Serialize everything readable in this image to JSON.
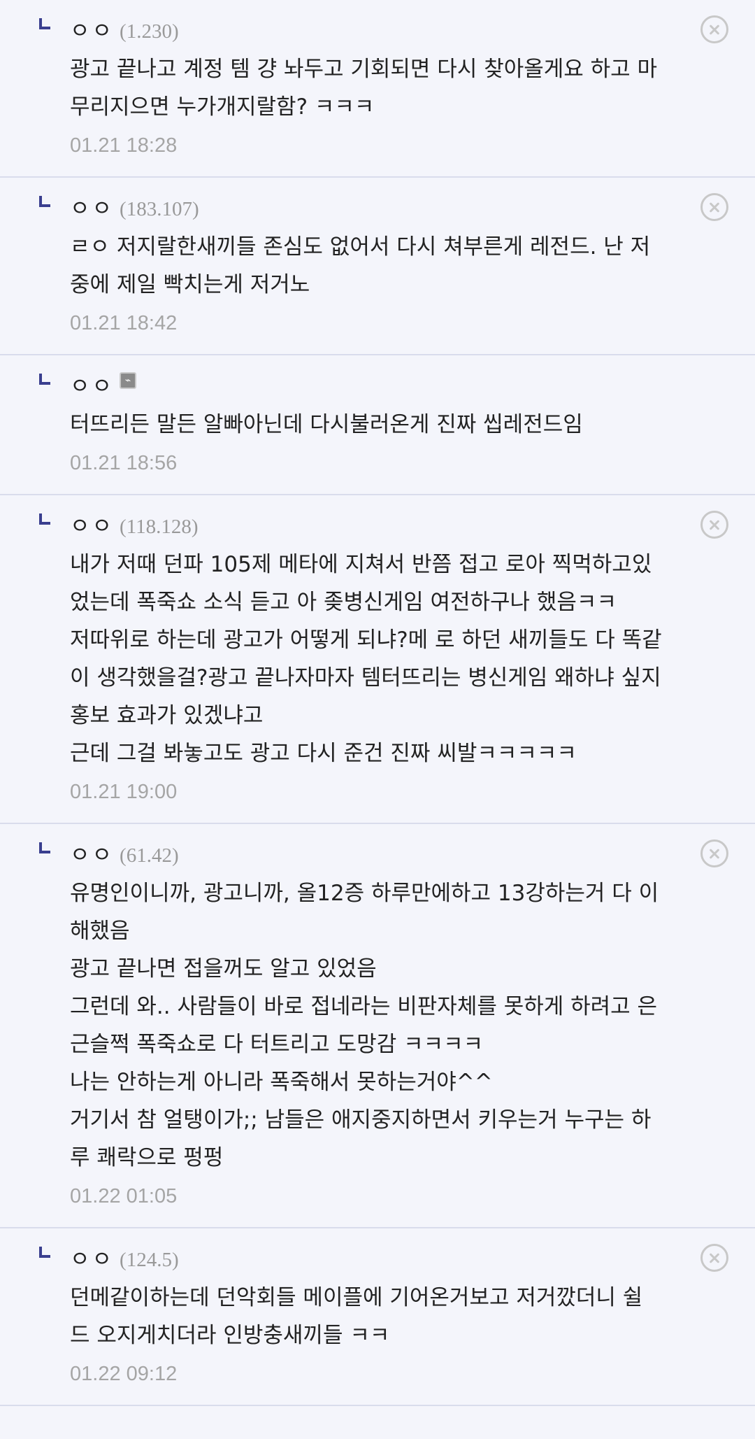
{
  "comments": [
    {
      "nickname": "ㅇㅇ",
      "ip": "(1.230)",
      "lines": [
        "광고 끝나고 계정 템 걍 놔두고 기회되면 다시 찾아올게요 하고 마",
        "무리지으면 누가개지랄함? ㅋㅋㅋ"
      ],
      "date": "01.21 18:28",
      "mobile": false,
      "deletable": true
    },
    {
      "nickname": "ㅇㅇ",
      "ip": "(183.107)",
      "lines": [
        "ㄹㅇ 저지랄한새끼들 존심도 없어서 다시 쳐부른게 레전드. 난 저",
        "중에 제일 빡치는게 저거노"
      ],
      "date": "01.21 18:42",
      "mobile": false,
      "deletable": true
    },
    {
      "nickname": "ㅇㅇ",
      "ip": "",
      "lines": [
        "터뜨리든 말든 알빠아닌데 다시불러온게 진짜 씹레전드임"
      ],
      "date": "01.21 18:56",
      "mobile": true,
      "deletable": false
    },
    {
      "nickname": "ㅇㅇ",
      "ip": "(118.128)",
      "lines": [
        "내가 저때 던파 105제 메타에 지쳐서 반쯤 접고 로아 찍먹하고있",
        "었는데 폭죽쇼 소식 듣고 아 좆병신게임 여전하구나 했음ㅋㅋ",
        "저따위로 하는데 광고가 어떻게 되냐?메 로 하던 새끼들도 다 똑같",
        "이 생각했을걸?광고 끝나자마자 템터뜨리는 병신게임 왜하냐 싶지",
        "홍보 효과가 있겠냐고",
        "근데 그걸 봐놓고도 광고 다시 준건 진짜 씨발ㅋㅋㅋㅋㅋ"
      ],
      "date": "01.21 19:00",
      "mobile": false,
      "deletable": true
    },
    {
      "nickname": "ㅇㅇ",
      "ip": "(61.42)",
      "lines": [
        "유명인이니까, 광고니까, 올12증 하루만에하고 13강하는거 다 이",
        "해했음",
        "광고 끝나면 접을꺼도 알고 있었음",
        "그런데 와.. 사람들이 바로 접네라는 비판자체를 못하게 하려고 은",
        "근슬쩍 폭죽쇼로 다 터트리고 도망감 ㅋㅋㅋㅋ",
        "나는 안하는게 아니라 폭죽해서 못하는거야^^",
        "거기서 참 얼탱이가;; 남들은 애지중지하면서 키우는거 누구는 하",
        "루 쾌락으로 펑펑"
      ],
      "date": "01.22 01:05",
      "mobile": false,
      "deletable": true
    },
    {
      "nickname": "ㅇㅇ",
      "ip": "(124.5)",
      "lines": [
        "던메같이하는데 던악회들 메이플에 기어온거보고 저거깠더니 쉴",
        "드 오지게치더라 인방충새끼들 ㅋㅋ"
      ],
      "date": "01.22 09:12",
      "mobile": false,
      "deletable": true
    }
  ]
}
